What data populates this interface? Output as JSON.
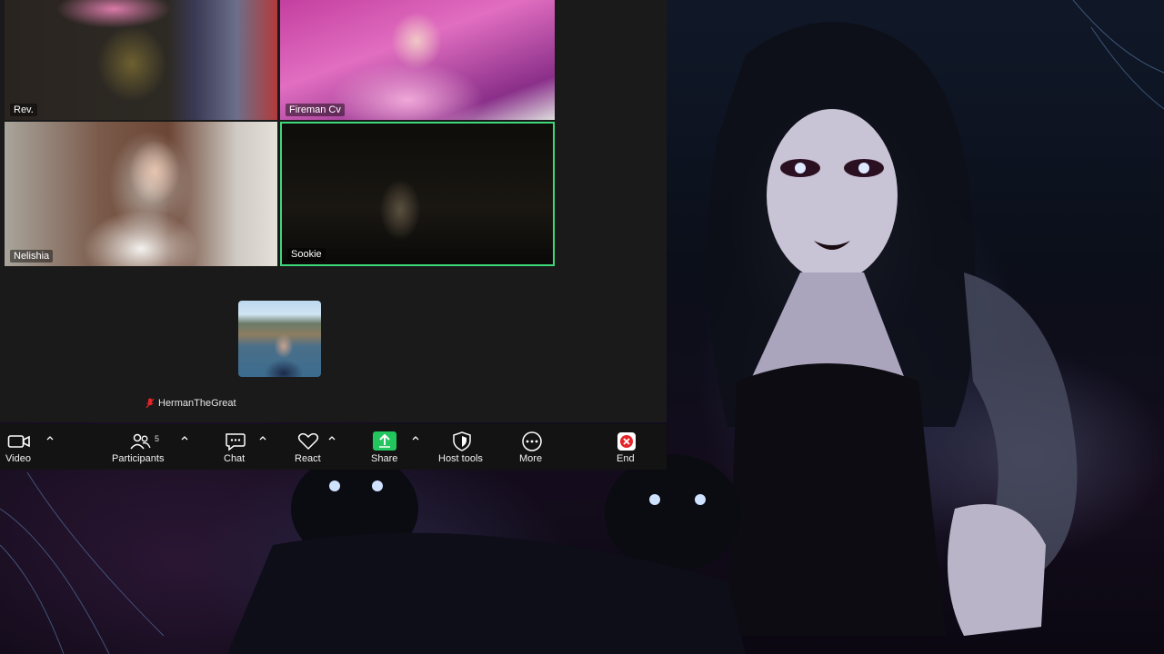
{
  "participants": {
    "tiles": [
      {
        "name": "Rev."
      },
      {
        "name": "Fireman Cv"
      },
      {
        "name": "Nelishia"
      },
      {
        "name": "Sookie"
      }
    ],
    "self_name": "HermanTheGreat"
  },
  "toolbar": {
    "video_label": "Video",
    "participants_label": "Participants",
    "participants_count": "5",
    "chat_label": "Chat",
    "react_label": "React",
    "share_label": "Share",
    "host_tools_label": "Host tools",
    "more_label": "More",
    "end_label": "End"
  },
  "colors": {
    "active_speaker_border": "#3ed87a",
    "share_green": "#22c55e",
    "end_red": "#e5252a",
    "toolbar_bg": "#131313"
  },
  "icons": {
    "video": "video-camera-icon",
    "participants": "people-icon",
    "chat": "chat-bubble-icon",
    "react": "heart-icon",
    "share": "share-arrow-icon",
    "host_tools": "shield-icon",
    "more": "ellipsis-icon",
    "end": "close-x-icon",
    "muted": "mic-muted-icon"
  }
}
